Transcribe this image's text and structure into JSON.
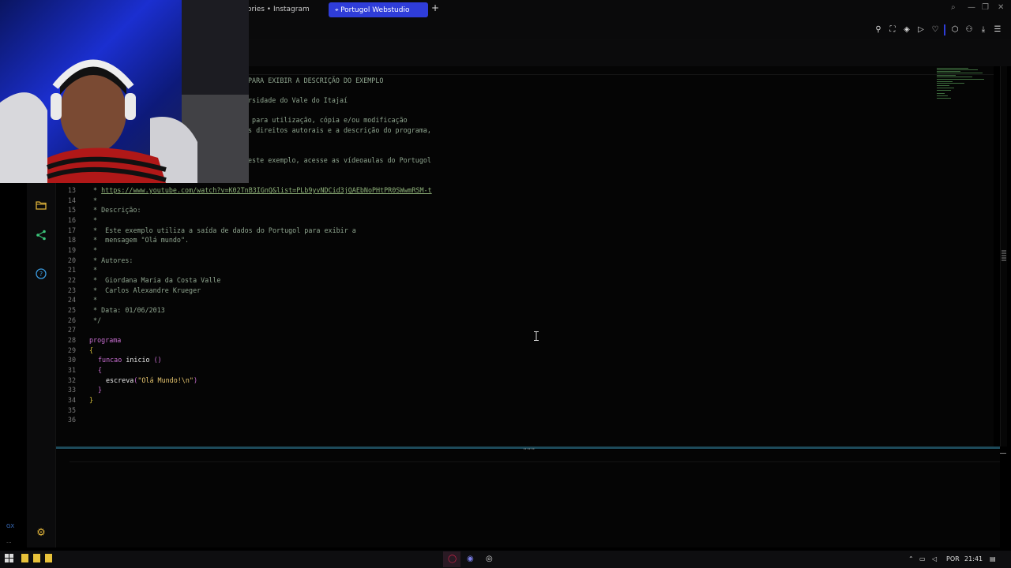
{
  "browser": {
    "tabs": [
      {
        "label": "ories • Instagram"
      },
      {
        "label": "Portugol Webstudio"
      }
    ],
    "new_tab": "+"
  },
  "editor": {
    "partial_lines": [
      "PARA EXIBIR A DESCRIÇÃO DO EXEMPLO",
      "rsidade do Vale do Itajaí",
      " para utilização, cópia e/ou modificação",
      "s direitos autorais e a descrição do programa,",
      "este exemplo, acesse as vídeoaulas do Portugol"
    ],
    "link": "https://www.youtube.com/watch?v=K02TnB3IGnQ&list=PLb9yvNDCid3jQAEbNoPHtPR0SWwmRSM-t",
    "numbers": [
      "13",
      "14",
      "15",
      "16",
      "17",
      "18",
      "19",
      "20",
      "21",
      "22",
      "23",
      "24",
      "25",
      "26",
      "27",
      "28",
      "29",
      "30",
      "31",
      "32",
      "33",
      "34",
      "35",
      "36"
    ],
    "comment_lines": {
      "l14": " *",
      "l15": " * Descrição:",
      "l16": " *",
      "l17": " *  Este exemplo utiliza a saída de dados do Portugol para exibir a",
      "l18": " *  mensagem \"Olá mundo\".",
      "l19": " *",
      "l20": " * Autores:",
      "l21": " *",
      "l22": " *  Giordana Maria da Costa Valle",
      "l23": " *  Carlos Alexandre Krueger",
      "l24": " *",
      "l25": " * Data: 01/06/2013",
      "l26": " */"
    },
    "link_prefix": " * ",
    "code": {
      "programa": "programa",
      "open_brace": "{",
      "funcao": "funcao",
      "inicio": "inicio",
      "parens": " ()",
      "inner_open": "{",
      "escreva": "escreva",
      "call_open": "(",
      "string": "\"Olá Mundo!\\n\"",
      "call_close": ")",
      "inner_close": "}",
      "close_brace": "}"
    }
  },
  "sidebar": {
    "items": [
      {
        "icon": "folder-icon",
        "glyph": "🗀"
      },
      {
        "icon": "share-icon",
        "glyph": "⋖"
      },
      {
        "icon": "help-icon",
        "glyph": "?"
      },
      {
        "icon": "gear-icon",
        "glyph": "⚙"
      }
    ]
  },
  "taskbar": {
    "lang": "POR",
    "time": "21:41"
  },
  "colors": {
    "accent": "#2f3dd9",
    "comment": "#8fa58f",
    "keyword": "#c86fd1",
    "string": "#e6c56f",
    "brace": "#d8c23a",
    "divider": "#1d4a5a"
  }
}
